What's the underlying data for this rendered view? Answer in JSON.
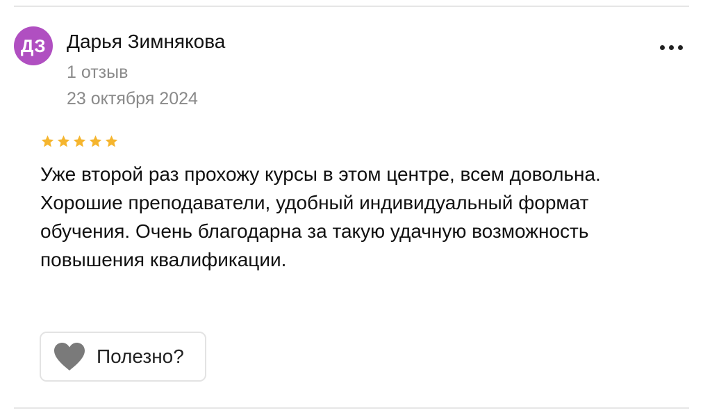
{
  "review": {
    "author": {
      "initials": "ДЗ",
      "name": "Дарья Зимнякова",
      "review_count": "1 отзыв",
      "avatar_color": "#b04fc1"
    },
    "date": "23 октября 2024",
    "rating": 5,
    "rating_max": 5,
    "star_color": "#f5b52e",
    "text_lines": [
      "Уже второй раз прохожу курсы в этом центре, всем довольна.",
      "Хорошие преподаватели, удобный индивидуальный формат обучения. Очень благодарна за такую удачную возможность повышения квалификации."
    ],
    "more_icon": "more-dots-icon",
    "helpful": {
      "label": "Полезно?",
      "icon": "heart-icon",
      "icon_color": "#7a7a7a"
    }
  }
}
